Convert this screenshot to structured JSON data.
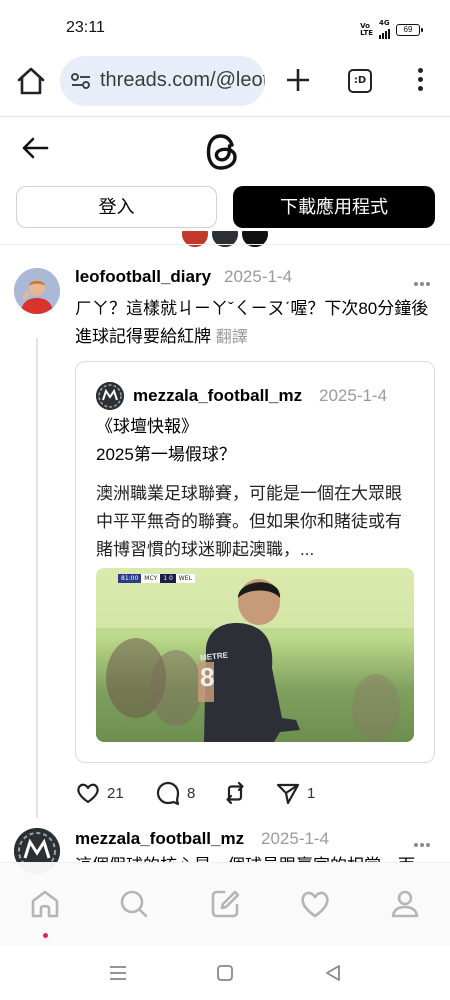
{
  "status_bar": {
    "time": "23:11",
    "network_top": "Vo",
    "network_bottom": "LTE",
    "signal_label": "4G",
    "battery": "69"
  },
  "browser": {
    "url": "threads.com/@leofootball_diary",
    "tabs_icon_label": ":D"
  },
  "header": {
    "login_label": "登入",
    "download_label": "下載應用程式"
  },
  "post": {
    "username": "leofootball_diary",
    "date": "2025-1-4",
    "text": "ㄏㄚ？這樣就ㄐㄧㄚˇㄑㄧㄡˊ喔？下次80分鐘後進球記得要給紅牌",
    "translate_label": "翻譯",
    "quote": {
      "username": "mezzala_football_mz",
      "date": "2025-1-4",
      "title_line1": "《球壇快報》",
      "title_line2": "2025第一場假球？",
      "body": "澳洲職業足球聯賽，可能是一個在大眾眼中平平無奇的聯賽。但如果你和賭徒或有賭博習慣的球迷聊起澳職，...",
      "scoreboard_time": "81:00",
      "scoreboard_home": "MCY",
      "scoreboard_score": "1 0",
      "scoreboard_away": "WEL",
      "shirt_name": "METRE",
      "shirt_number": "8"
    },
    "likes": "21",
    "replies": "8",
    "reposts": "",
    "shares": "1"
  },
  "post2": {
    "username": "mezzala_football_mz",
    "date": "2025-1-4",
    "text": "這個假球的核心是一個球員跟贏家的相當，而"
  },
  "colors": {
    "accent": "#000000",
    "muted": "#9a9a9a",
    "notification_dot": "#e0245e",
    "url_bar_bg": "#e8eef9"
  }
}
